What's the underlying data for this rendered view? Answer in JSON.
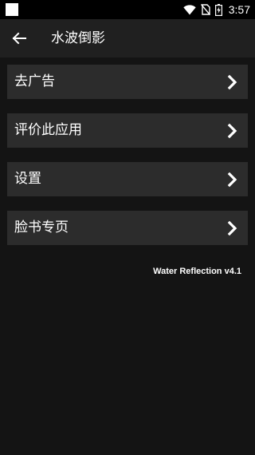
{
  "status_bar": {
    "time": "3:57",
    "icons": [
      "notification-icon",
      "wifi-icon",
      "no-sim-icon",
      "battery-charging-icon"
    ]
  },
  "app_bar": {
    "back_icon": "arrow-left-icon",
    "title": "水波倒影"
  },
  "menu": {
    "items": [
      {
        "label": "去广告",
        "icon": "chevron-right-icon"
      },
      {
        "label": "评价此应用",
        "icon": "chevron-right-icon"
      },
      {
        "label": "设置",
        "icon": "chevron-right-icon"
      },
      {
        "label": "脸书专页",
        "icon": "chevron-right-icon"
      }
    ]
  },
  "footer": {
    "version": "Water Reflection v4.1"
  },
  "colors": {
    "background": "#141414",
    "app_bar": "#202020",
    "menu_item": "#2c2c2c",
    "status_bar": "#000000",
    "text": "#ffffff"
  }
}
